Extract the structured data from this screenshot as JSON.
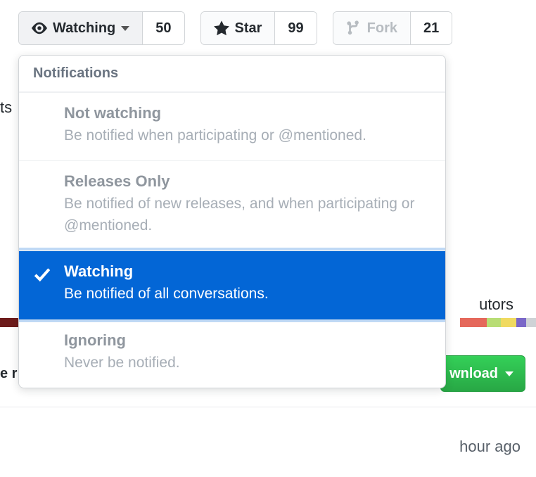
{
  "topbar": {
    "watch": {
      "label": "Watching",
      "count": "50"
    },
    "star": {
      "label": "Star",
      "count": "99"
    },
    "fork": {
      "label": "Fork",
      "count": "21"
    }
  },
  "dropdown": {
    "header": "Notifications",
    "items": [
      {
        "title": "Not watching",
        "desc": "Be notified when participating or @mentioned."
      },
      {
        "title": "Releases Only",
        "desc": "Be notified of new releases, and when participating or @mentioned."
      },
      {
        "title": "Watching",
        "desc": "Be notified of all conversations."
      },
      {
        "title": "Ignoring",
        "desc": "Never be notified."
      }
    ],
    "selected_index": 2
  },
  "background": {
    "frag_left_top": "ts",
    "frag_right_mid": "utors",
    "frag_left_mid": "e r",
    "download_label": "wnload",
    "frag_right_bottom": "hour ago"
  }
}
